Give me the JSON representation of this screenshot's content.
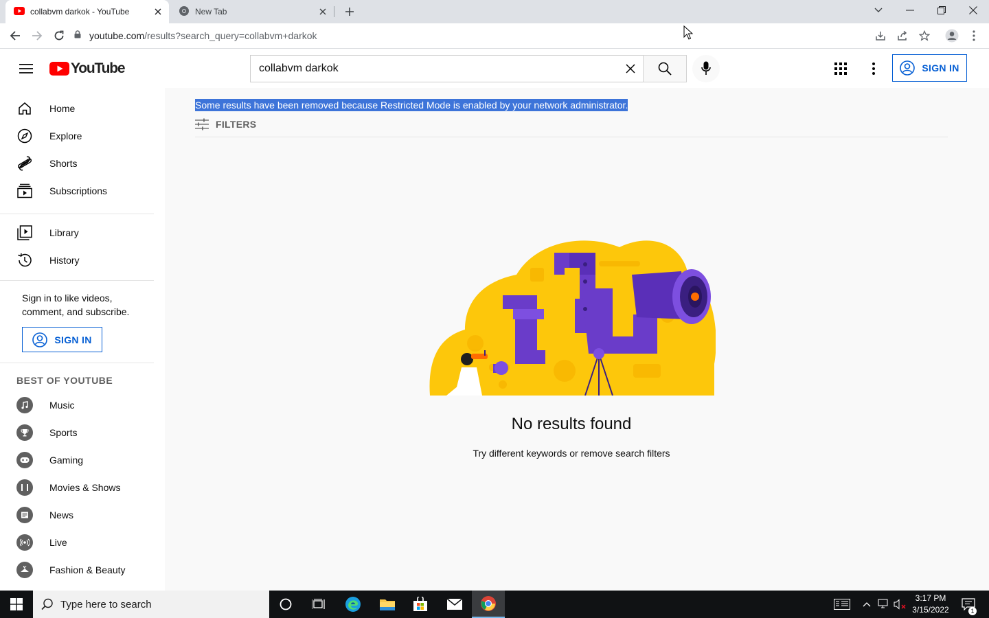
{
  "browser": {
    "tabs": [
      {
        "title": "collabvm darkok - YouTube",
        "favicon": "youtube-icon",
        "active": true
      },
      {
        "title": "New Tab",
        "favicon": "chrome-icon",
        "active": false
      }
    ],
    "url_host": "youtube.com",
    "url_path": "/results?search_query=collabvm+darkok"
  },
  "masthead": {
    "logo_text": "YouTube",
    "search_value": "collabvm darkok",
    "sign_in_label": "SIGN IN"
  },
  "sidebar": {
    "primary": [
      {
        "label": "Home",
        "icon": "home-icon"
      },
      {
        "label": "Explore",
        "icon": "compass-icon"
      },
      {
        "label": "Shorts",
        "icon": "shorts-icon"
      },
      {
        "label": "Subscriptions",
        "icon": "subscriptions-icon"
      }
    ],
    "secondary": [
      {
        "label": "Library",
        "icon": "library-icon"
      },
      {
        "label": "History",
        "icon": "history-icon"
      }
    ],
    "signin_prompt": "Sign in to like videos, comment, and subscribe.",
    "signin_label": "SIGN IN",
    "best_heading": "BEST OF YOUTUBE",
    "best": [
      {
        "label": "Music",
        "icon": "music-icon"
      },
      {
        "label": "Sports",
        "icon": "trophy-icon"
      },
      {
        "label": "Gaming",
        "icon": "gamepad-icon"
      },
      {
        "label": "Movies & Shows",
        "icon": "film-icon"
      },
      {
        "label": "News",
        "icon": "news-icon"
      },
      {
        "label": "Live",
        "icon": "live-icon"
      },
      {
        "label": "Fashion & Beauty",
        "icon": "hanger-icon"
      }
    ]
  },
  "main": {
    "notice": "Some results have been removed because Restricted Mode is enabled by your network administrator.",
    "filters_label": "FILTERS",
    "no_results_title": "No results found",
    "no_results_subtitle": "Try different keywords or remove search filters"
  },
  "taskbar": {
    "search_placeholder": "Type here to search",
    "time": "3:17 PM",
    "date": "3/15/2022",
    "notification_count": "1"
  },
  "colors": {
    "brand_red": "#ff0000",
    "link_blue": "#065fd4",
    "selection_blue": "#3d74d9",
    "illustration_yellow": "#fdc70b",
    "illustration_purple": "#6a3cc9"
  }
}
